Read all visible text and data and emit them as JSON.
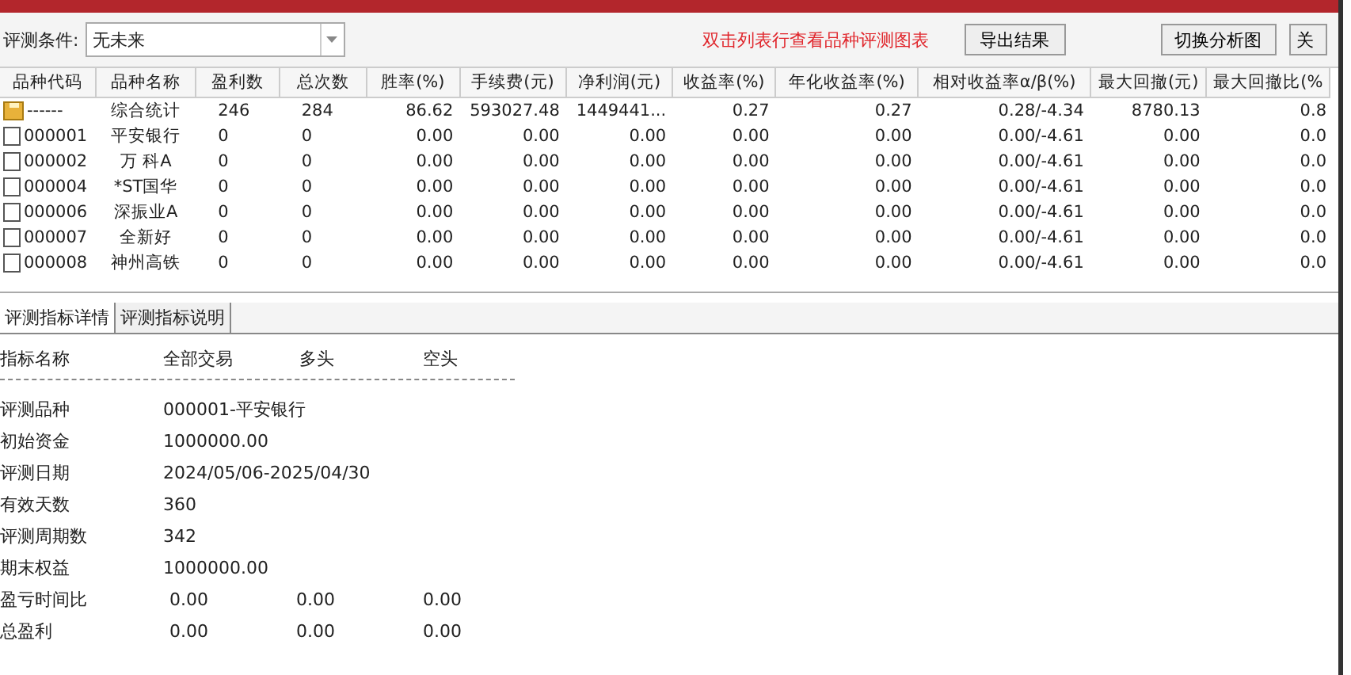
{
  "toolbar": {
    "condition_label": "评测条件:",
    "condition_value": "无未来",
    "hint": "双击列表行查看品种评测图表",
    "buttons": [
      "导出结果",
      "切换分析图",
      "关"
    ]
  },
  "table": {
    "columns": [
      "品种代码",
      "品种名称",
      "盈利数",
      "总次数",
      "胜率(%)",
      "手续费(元)",
      "净利润(元)",
      "收益率(%)",
      "年化收益率(%)",
      "相对收益率α/β(%)",
      "最大回撤(元)",
      "最大回撤比(%"
    ],
    "rows": [
      {
        "kind": "summary",
        "cells": [
          "------",
          "综合统计",
          "246",
          "284",
          "86.62",
          "593027.48",
          "1449441...",
          "0.27",
          "0.27",
          "0.28/-4.34",
          "8780.13",
          "0.8"
        ]
      },
      {
        "kind": "stock",
        "cells": [
          "000001",
          "平安银行",
          "0",
          "0",
          "0.00",
          "0.00",
          "0.00",
          "0.00",
          "0.00",
          "0.00/-4.61",
          "0.00",
          "0.0"
        ]
      },
      {
        "kind": "stock",
        "cells": [
          "000002",
          "万 科A",
          "0",
          "0",
          "0.00",
          "0.00",
          "0.00",
          "0.00",
          "0.00",
          "0.00/-4.61",
          "0.00",
          "0.0"
        ]
      },
      {
        "kind": "stock",
        "cells": [
          "000004",
          "*ST国华",
          "0",
          "0",
          "0.00",
          "0.00",
          "0.00",
          "0.00",
          "0.00",
          "0.00/-4.61",
          "0.00",
          "0.0"
        ]
      },
      {
        "kind": "stock",
        "cells": [
          "000006",
          "深振业A",
          "0",
          "0",
          "0.00",
          "0.00",
          "0.00",
          "0.00",
          "0.00",
          "0.00/-4.61",
          "0.00",
          "0.0"
        ]
      },
      {
        "kind": "stock",
        "cells": [
          "000007",
          "全新好",
          "0",
          "0",
          "0.00",
          "0.00",
          "0.00",
          "0.00",
          "0.00",
          "0.00/-4.61",
          "0.00",
          "0.0"
        ]
      },
      {
        "kind": "stock",
        "cells": [
          "000008",
          "神州高铁",
          "0",
          "0",
          "0.00",
          "0.00",
          "0.00",
          "0.00",
          "0.00",
          "0.00/-4.61",
          "0.00",
          "0.0"
        ]
      }
    ]
  },
  "tabs": [
    {
      "label": "评测指标详情",
      "selected": true
    },
    {
      "label": "评测指标说明",
      "selected": false
    }
  ],
  "details": {
    "header": [
      "指标名称",
      "全部交易",
      "多头",
      "空头"
    ],
    "rows": [
      {
        "label": "评测品种",
        "values": [
          "000001-平安银行"
        ]
      },
      {
        "label": "初始资金",
        "values": [
          "1000000.00"
        ]
      },
      {
        "label": "评测日期",
        "values": [
          "2024/05/06-2025/04/30"
        ]
      },
      {
        "label": "有效天数",
        "values": [
          "360"
        ]
      },
      {
        "label": "评测周期数",
        "values": [
          "342"
        ]
      },
      {
        "label": "期末权益",
        "values": [
          "1000000.00"
        ]
      },
      {
        "label": "盈亏时间比",
        "values": [
          "0.00",
          "0.00",
          "0.00"
        ]
      },
      {
        "label": "总盈利",
        "values": [
          "0.00",
          "0.00",
          "0.00"
        ]
      }
    ]
  }
}
